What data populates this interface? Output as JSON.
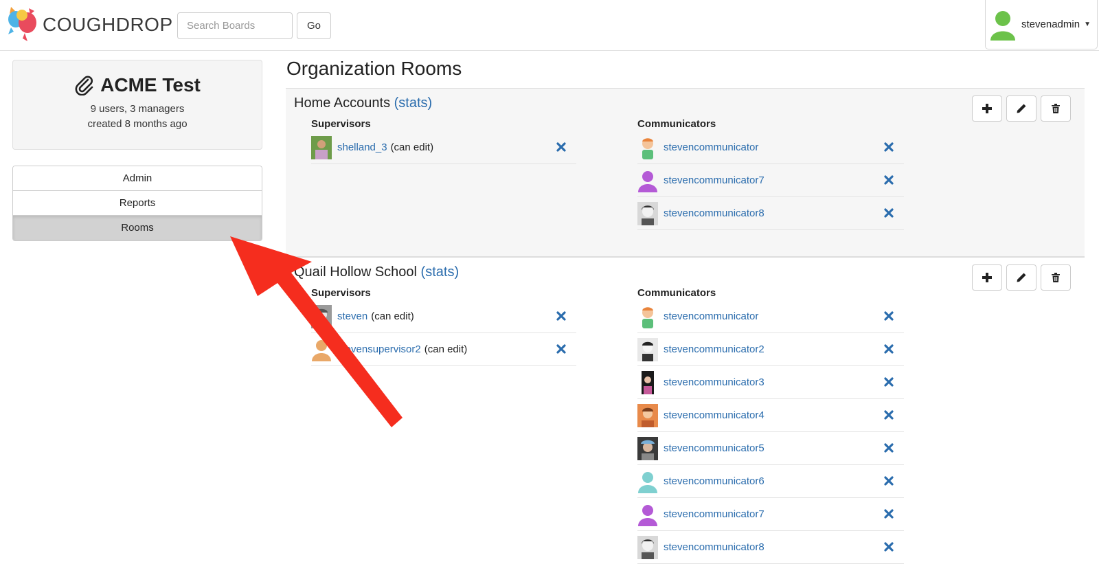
{
  "header": {
    "logo_text": "COUGHDROP",
    "search": {
      "placeholder": "Search Boards",
      "value": ""
    },
    "go_label": "Go",
    "username": "stevenadmin"
  },
  "org": {
    "name": "ACME Test",
    "stats_line": "9 users, 3 managers",
    "created_line": "created 8 months ago"
  },
  "nav": {
    "items": [
      {
        "label": "Admin",
        "active": false
      },
      {
        "label": "Reports",
        "active": false
      },
      {
        "label": "Rooms",
        "active": true
      }
    ]
  },
  "main": {
    "title": "Organization Rooms",
    "supervisors_header": "Supervisors",
    "communicators_header": "Communicators",
    "rooms": [
      {
        "name": "Home Accounts",
        "stats_label": "(stats)",
        "supervisors": [
          {
            "name": "shelland_3",
            "perm": "(can edit)",
            "avatar": "photo-green"
          }
        ],
        "communicators": [
          {
            "name": "stevencommunicator",
            "avatar": "cartoon-boy"
          },
          {
            "name": "stevencommunicator7",
            "avatar": "silhouette-purple"
          },
          {
            "name": "stevencommunicator8",
            "avatar": "photo-bw"
          }
        ]
      },
      {
        "name": "Quail Hollow School",
        "stats_label": "(stats)",
        "supervisors": [
          {
            "name": "steven",
            "perm": "(can edit)",
            "avatar": "photo-gray"
          },
          {
            "name": "stevensupervisor2",
            "perm": "(can edit)",
            "avatar": "silhouette-orange"
          }
        ],
        "communicators": [
          {
            "name": "stevencommunicator",
            "avatar": "cartoon-boy"
          },
          {
            "name": "stevencommunicator2",
            "avatar": "photo-bw"
          },
          {
            "name": "stevencommunicator3",
            "avatar": "photo-dark"
          },
          {
            "name": "stevencommunicator4",
            "avatar": "photo-orange"
          },
          {
            "name": "stevencommunicator5",
            "avatar": "photo-cap"
          },
          {
            "name": "stevencommunicator6",
            "avatar": "silhouette-teal"
          },
          {
            "name": "stevencommunicator7",
            "avatar": "silhouette-purple"
          },
          {
            "name": "stevencommunicator8",
            "avatar": "photo-bw"
          }
        ]
      }
    ]
  },
  "colors": {
    "link": "#2a6cad",
    "active_nav": "#d2d2d2",
    "annotation_arrow": "#f52d1e"
  }
}
